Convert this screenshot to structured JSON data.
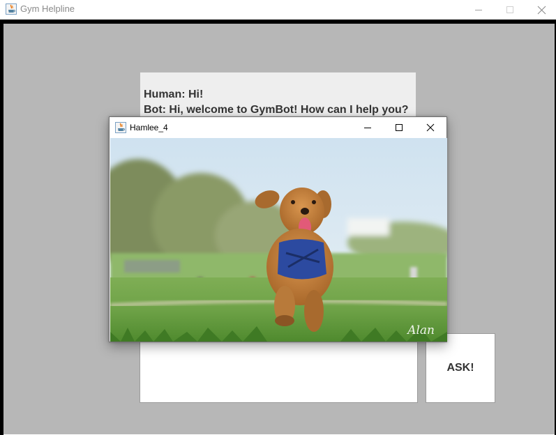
{
  "main_window": {
    "title": "Gym Helpline",
    "icon": "java-app-icon",
    "controls": [
      "minimize-icon",
      "maximize-icon",
      "close-icon"
    ]
  },
  "chat": {
    "messages": [
      "Human: Hi!",
      "Bot: Hi, welcome to GymBot! How can I help you?"
    ]
  },
  "input": {
    "value": ""
  },
  "ask_button": {
    "label": "ASK!"
  },
  "popup_window": {
    "title": "Hamlee_4",
    "icon": "java-app-icon",
    "controls": [
      "minimize-icon",
      "maximize-icon",
      "close-icon"
    ],
    "image": {
      "subject": "dog-photo",
      "watermark": "Alan"
    }
  },
  "colors": {
    "client_background": "#b7b7b7",
    "chat_background": "#eeeeee",
    "text": "#333333",
    "title_inactive": "#8a8a8a"
  }
}
